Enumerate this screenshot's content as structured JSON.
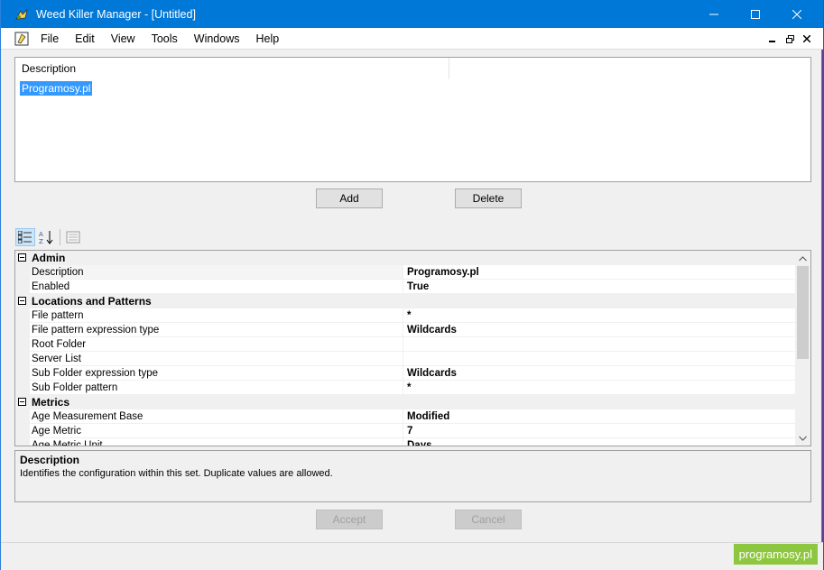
{
  "window": {
    "title": "Weed Killer Manager - [Untitled]"
  },
  "menu": {
    "items": [
      "File",
      "Edit",
      "View",
      "Tools",
      "Windows",
      "Help"
    ]
  },
  "list": {
    "column_header": "Description",
    "rows": [
      "Programosy.pl"
    ]
  },
  "buttons": {
    "add": "Add",
    "delete": "Delete",
    "accept": "Accept",
    "cancel": "Cancel"
  },
  "grid": {
    "rows": [
      {
        "type": "category",
        "label": "Admin"
      },
      {
        "type": "prop",
        "name": "Description",
        "value": "Programosy.pl"
      },
      {
        "type": "prop",
        "name": "Enabled",
        "value": "True"
      },
      {
        "type": "category",
        "label": "Locations and Patterns"
      },
      {
        "type": "prop",
        "name": "File pattern",
        "value": "*"
      },
      {
        "type": "prop",
        "name": "File pattern expression type",
        "value": "Wildcards"
      },
      {
        "type": "prop",
        "name": "Root Folder",
        "value": ""
      },
      {
        "type": "prop",
        "name": "Server List",
        "value": ""
      },
      {
        "type": "prop",
        "name": "Sub Folder expression type",
        "value": "Wildcards"
      },
      {
        "type": "prop",
        "name": "Sub Folder pattern",
        "value": "*"
      },
      {
        "type": "category",
        "label": "Metrics"
      },
      {
        "type": "prop",
        "name": "Age Measurement Base",
        "value": "Modified"
      },
      {
        "type": "prop",
        "name": "Age Metric",
        "value": "7"
      },
      {
        "type": "prop",
        "name": "Age Metric Unit",
        "value": "Days"
      }
    ]
  },
  "description_panel": {
    "title": "Description",
    "text": "Identifies the configuration within this set.  Duplicate values are allowed."
  },
  "watermark": "programosy.pl",
  "colors": {
    "titlebar": "#0078d7",
    "selection": "#3399ff",
    "watermark": "#8dc63f"
  }
}
